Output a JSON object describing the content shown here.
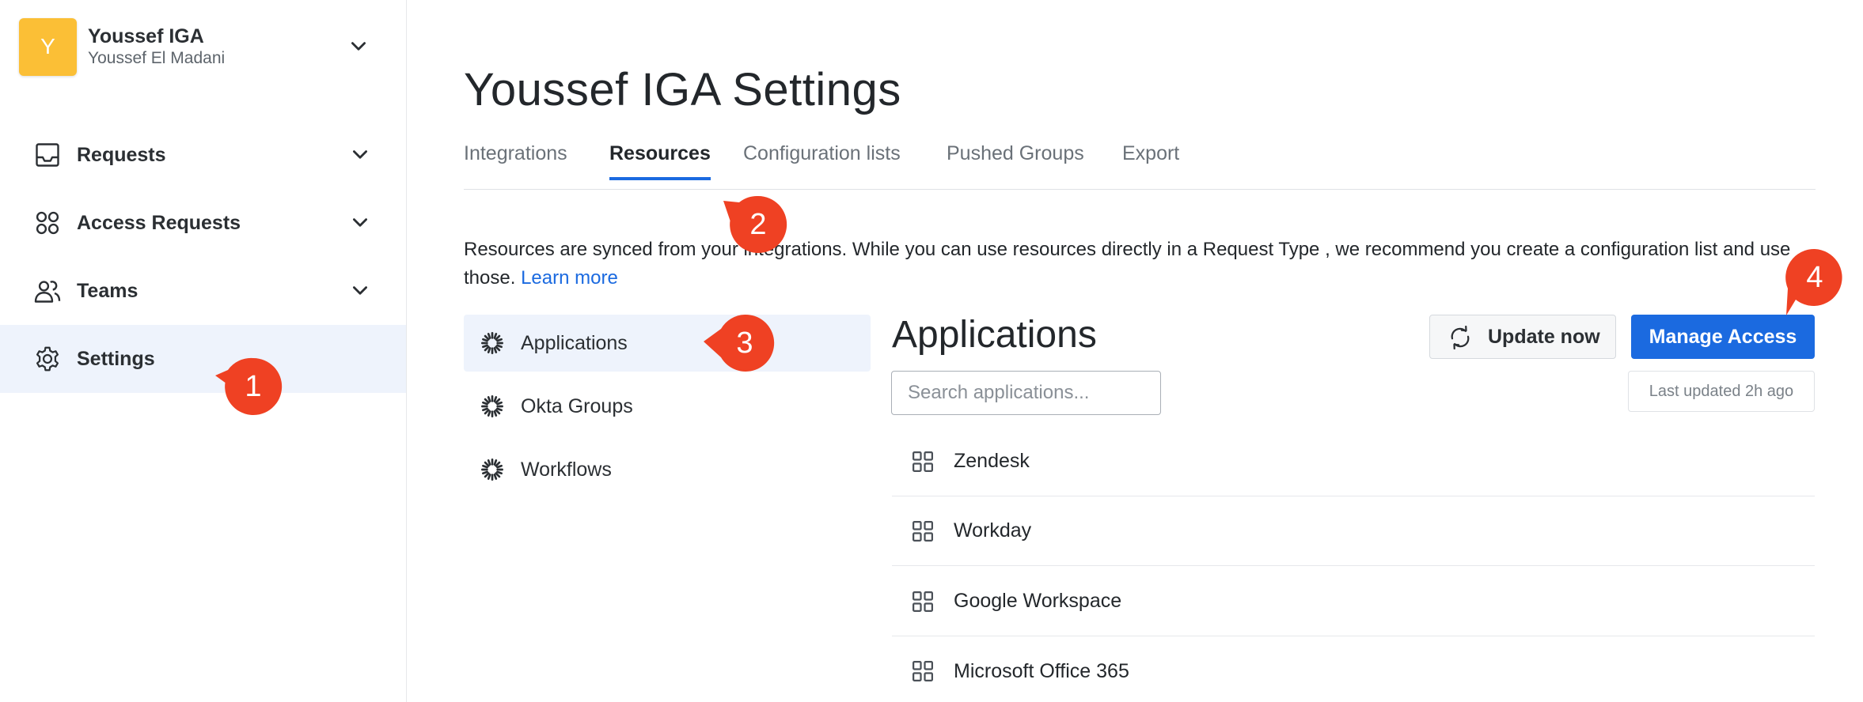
{
  "workspace": {
    "initial": "Y",
    "name": "Youssef IGA",
    "user": "Youssef El Madani"
  },
  "sidebar": {
    "items": [
      {
        "label": "Requests",
        "icon": "inbox-icon",
        "has_chevron": true
      },
      {
        "label": "Access Requests",
        "icon": "circles-icon",
        "has_chevron": true
      },
      {
        "label": "Teams",
        "icon": "users-icon",
        "has_chevron": true
      },
      {
        "label": "Settings",
        "icon": "gear-icon",
        "has_chevron": false,
        "active": true
      }
    ]
  },
  "page": {
    "title": "Youssef IGA Settings"
  },
  "tabs": [
    {
      "label": "Integrations"
    },
    {
      "label": "Resources",
      "active": true
    },
    {
      "label": "Configuration lists"
    },
    {
      "label": "Pushed Groups"
    },
    {
      "label": "Export"
    }
  ],
  "description": {
    "text": "Resources are synced from your integrations. While you can use resources directly in a Request Type , we recommend you create a configuration list and use those.",
    "link": "Learn more"
  },
  "resources": [
    {
      "label": "Applications",
      "active": true
    },
    {
      "label": "Okta Groups"
    },
    {
      "label": "Workflows"
    }
  ],
  "apps_panel": {
    "title": "Applications",
    "update_label": "Update now",
    "manage_label": "Manage Access",
    "search_placeholder": "Search applications...",
    "last_updated": "Last updated 2h ago",
    "items": [
      {
        "label": "Zendesk"
      },
      {
        "label": "Workday"
      },
      {
        "label": "Google Workspace"
      },
      {
        "label": "Microsoft Office 365"
      }
    ]
  },
  "markers": [
    "1",
    "2",
    "3",
    "4"
  ],
  "colors": {
    "accent": "#1b6ae0",
    "avatar": "#fbbf36",
    "marker": "#ef4123",
    "active_bg": "#eef3fc"
  }
}
